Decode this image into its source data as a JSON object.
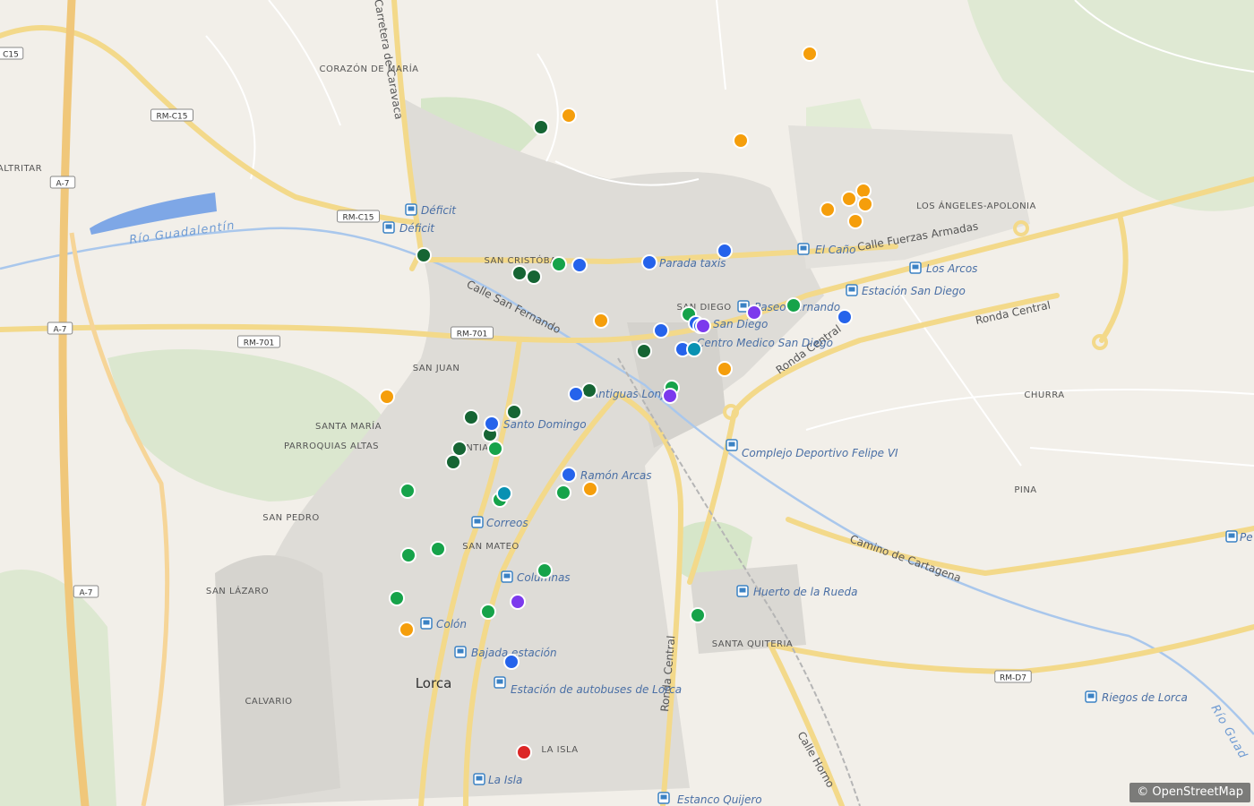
{
  "map": {
    "attribution": "© OpenStreetMap",
    "city_label": "Lorca",
    "river_labels": [
      "Río Guadalentín",
      "Río Guad"
    ],
    "road_labels": [
      "Calle San Fernando",
      "Calle Fuerzas Armadas",
      "Ronda Central",
      "Ronda Central",
      "Ronda Central",
      "Camino de Cartagena",
      "Calle Horno",
      "Carretera de Caravaca"
    ],
    "road_shields": [
      "C15",
      "RM-C15",
      "RM-C15",
      "A-7",
      "A-7",
      "A-7",
      "RM-701",
      "RM-701",
      "RM-D7"
    ],
    "area_labels": [
      "CORAZÓN DE MARÍA",
      "SAN CRISTÓBAL",
      "SAN DIEGO",
      "SAN JUAN",
      "SANTA MARÍA",
      "PARROQUIAS ALTAS",
      "SANTIAGO",
      "SAN PEDRO",
      "SAN MATEO",
      "SAN LÁZARO",
      "CALVARIO",
      "LA ISLA",
      "SANTA QUITERIA",
      "LOS ÁNGELES-APOLONIA",
      "CHURRA",
      "PINA",
      "ALTRITAR"
    ],
    "stops": [
      "Déficit",
      "Déficit",
      "Parada taxis",
      "El Caño",
      "Los Arcos",
      "Estación San Diego",
      "Paseo Fernando",
      "San Diego",
      "Centro Medico San Diego",
      "Antiguas Lonjas",
      "Santo Domingo",
      "Ramón Arcas",
      "Correos",
      "Columnas",
      "Colón",
      "Bajada estación",
      "Estación de autobuses de Lorca",
      "La Isla",
      "Estanco Quijero",
      "Complejo Deportivo Felipe VI",
      "Huerto de la Rueda",
      "Riegos de Lorca",
      "Pe"
    ],
    "marker_colors": {
      "orange": "#f59e0b",
      "dark_green": "#166534",
      "green": "#16a34a",
      "blue": "#2563eb",
      "purple": "#7c3aed",
      "teal": "#0891b2",
      "red": "#dc2626"
    },
    "markers": [
      {
        "color": "orange"
      },
      {
        "color": "orange"
      },
      {
        "color": "orange"
      },
      {
        "color": "orange"
      },
      {
        "color": "orange"
      },
      {
        "color": "orange"
      },
      {
        "color": "orange"
      },
      {
        "color": "orange"
      },
      {
        "color": "orange"
      },
      {
        "color": "orange"
      },
      {
        "color": "orange"
      },
      {
        "color": "orange"
      },
      {
        "color": "orange"
      },
      {
        "color": "dark_green"
      },
      {
        "color": "dark_green"
      },
      {
        "color": "dark_green"
      },
      {
        "color": "dark_green"
      },
      {
        "color": "dark_green"
      },
      {
        "color": "dark_green"
      },
      {
        "color": "dark_green"
      },
      {
        "color": "dark_green"
      },
      {
        "color": "dark_green"
      },
      {
        "color": "dark_green"
      },
      {
        "color": "dark_green"
      },
      {
        "color": "green"
      },
      {
        "color": "green"
      },
      {
        "color": "green"
      },
      {
        "color": "green"
      },
      {
        "color": "green"
      },
      {
        "color": "green"
      },
      {
        "color": "green"
      },
      {
        "color": "green"
      },
      {
        "color": "green"
      },
      {
        "color": "green"
      },
      {
        "color": "green"
      },
      {
        "color": "green"
      },
      {
        "color": "green"
      },
      {
        "color": "green"
      },
      {
        "color": "blue"
      },
      {
        "color": "blue"
      },
      {
        "color": "blue"
      },
      {
        "color": "blue"
      },
      {
        "color": "blue"
      },
      {
        "color": "blue"
      },
      {
        "color": "blue"
      },
      {
        "color": "blue"
      },
      {
        "color": "blue"
      },
      {
        "color": "blue"
      },
      {
        "color": "blue"
      },
      {
        "color": "blue"
      },
      {
        "color": "purple"
      },
      {
        "color": "purple"
      },
      {
        "color": "purple"
      },
      {
        "color": "purple"
      },
      {
        "color": "teal"
      },
      {
        "color": "teal"
      },
      {
        "color": "red"
      }
    ]
  }
}
